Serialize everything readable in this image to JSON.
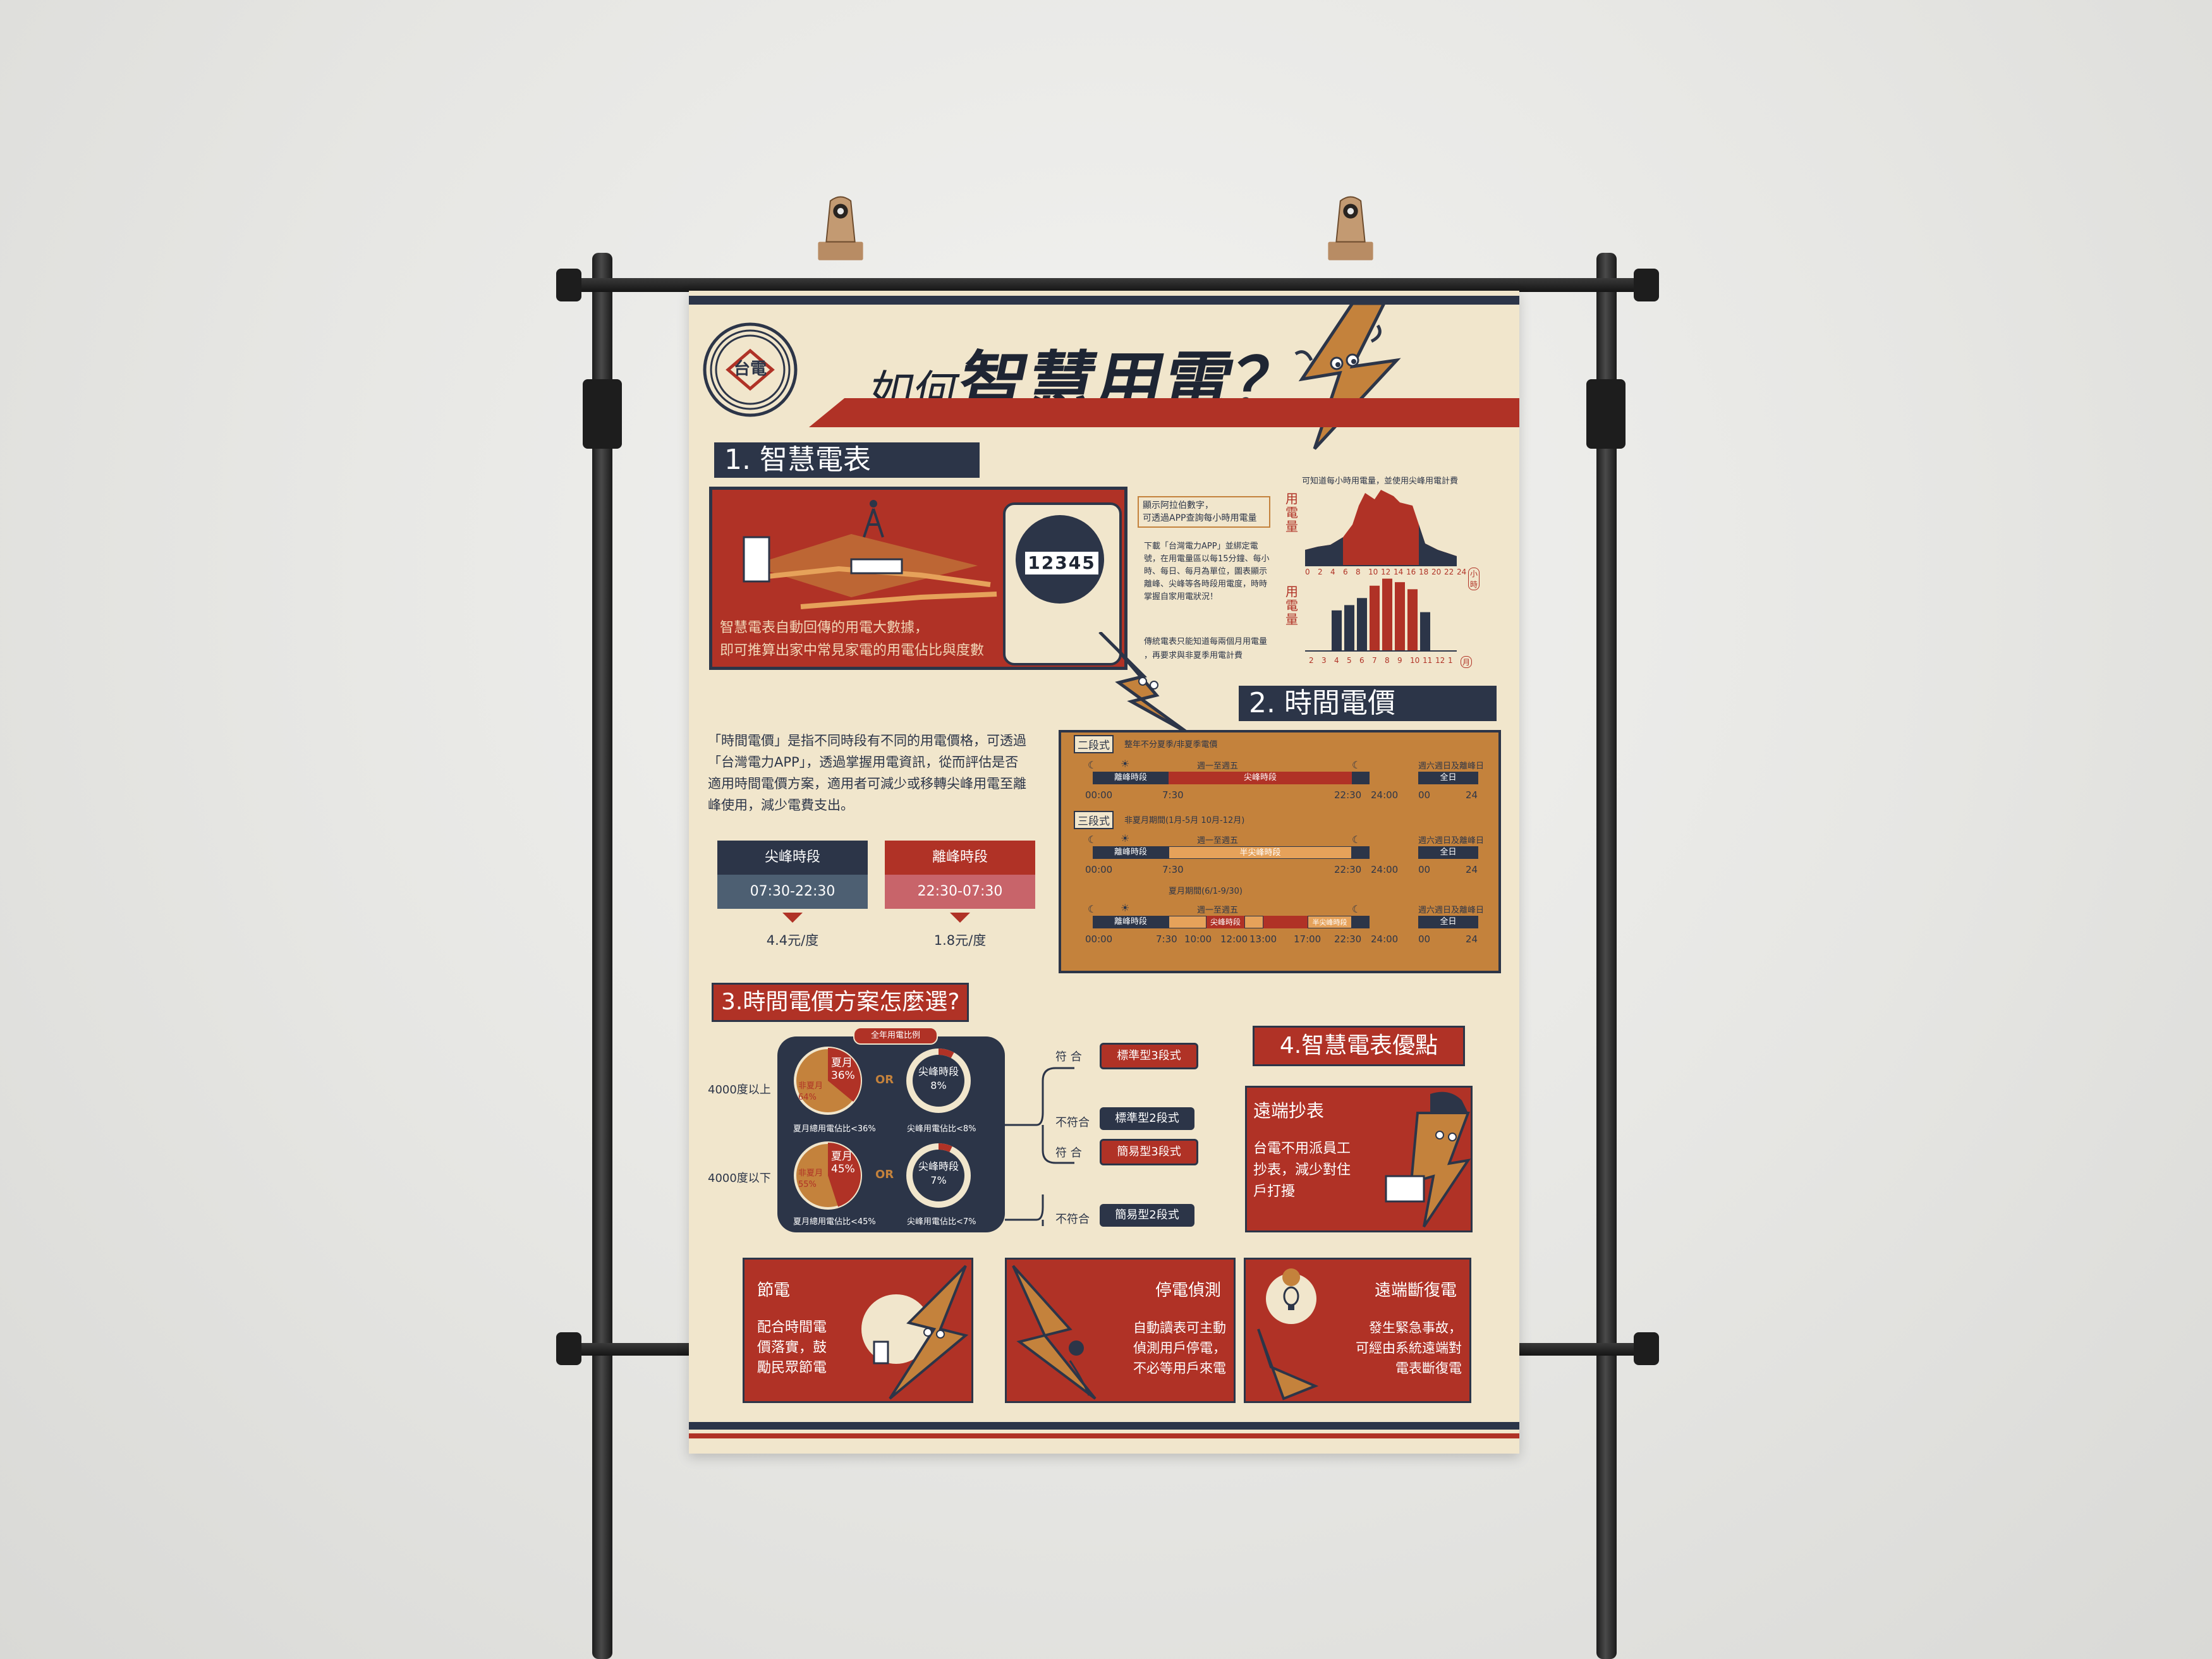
{
  "poster": {
    "title_prefix": "如何",
    "title_main": "智慧用電？",
    "logo_text": "台電",
    "colors": {
      "navy": "#2c3548",
      "red": "#b03226",
      "ochre": "#c4823c",
      "cream": "#f1e6cc"
    },
    "section1": {
      "heading": "1. 智慧電表",
      "meter_number": "12345",
      "caption_line1": "智慧電表自動回傳的用電大數據，",
      "caption_line2": "即可推算出家中常見家電的用電佔比與度數",
      "note1_line1": "顯示阿拉伯數字，",
      "note1_line2": "可透過APP查詢每小時用電量",
      "note2": "下載「台灣電力APP」並綁定電號，在用電量區以每15分鐘、每小時、每日、每月為單位，圖表顯示離峰、尖峰等各時段用電度，時時掌握自家用電狀況！",
      "note3_line1": "傳統電表只能知道每兩個月用電量",
      "note3_line2": "，再要求與非夏季用電計費",
      "chart_top_note": "可知道每小時用電量，並使用尖峰用電計費",
      "chart_ylabel": "用電量"
    },
    "chart_data": [
      {
        "type": "area",
        "ylabel": "用電量",
        "x_ticks": [
          "0",
          "2",
          "4",
          "6",
          "8",
          "10",
          "12",
          "14",
          "16",
          "18",
          "20",
          "22",
          "24"
        ],
        "x_unit": "小時"
      },
      {
        "type": "bar",
        "ylabel": "用電量",
        "categories": [
          "2",
          "3",
          "4",
          "5",
          "6",
          "7",
          "8",
          "9",
          "10",
          "11",
          "12",
          "1"
        ],
        "values": [
          0,
          0,
          2.3,
          2.6,
          3.0,
          3.7,
          4.1,
          3.9,
          3.5,
          2.2,
          0,
          0
        ],
        "x_unit": "月"
      }
    ],
    "section2": {
      "heading": "2. 時間電價",
      "body_line1": "「時間電價」是指不同時段有不同的用電價格，可透過",
      "body_line2": "「台灣電力APP」，透過掌握用電資訊，從而評估是否",
      "body_line3": "適用時間電價方案，適用者可減少或移轉尖峰用電至離",
      "body_line4": "峰使用，減少電費支出。",
      "peak_label": "尖峰時段",
      "peak_time": "07:30-22:30",
      "peak_price": "4.4元/度",
      "offpeak_label": "離峰時段",
      "offpeak_time": "22:30-07:30",
      "offpeak_price": "1.8元/度",
      "two_stage": {
        "tag": "二段式",
        "note": "整年不分夏季/非夏季電價",
        "weekday": "週一至週五",
        "offpeak": "離峰時段",
        "peak": "尖峰時段",
        "weekend": "週六週日及離峰日",
        "allday": "全日",
        "ticks_left": [
          "00:00",
          "7:30"
        ],
        "ticks_right": [
          "22:30",
          "24:00"
        ],
        "we_ticks": [
          "00",
          "24"
        ]
      },
      "three_stage": {
        "tag": "三段式",
        "note": "非夏月期間(1月-5月 10月-12月)",
        "weekday": "週一至週五",
        "offpeak": "離峰時段",
        "halfpeak": "半尖峰時段",
        "weekend": "週六週日及離峰日",
        "allday": "全日",
        "ticks_left": [
          "00:00",
          "7:30"
        ],
        "ticks_right": [
          "22:30",
          "24:00"
        ],
        "we_ticks": [
          "00",
          "24"
        ],
        "summer_note": "夏月期間(6/1-9/30)",
        "summer_weekday": "週一至週五",
        "summer_seg_off": "離峰時段",
        "summer_seg_peak": "尖峰時段",
        "summer_seg_half": "半尖峰時段",
        "summer_ticks": [
          "00:00",
          "7:30",
          "10:00",
          "12:00",
          "13:00",
          "17:00",
          "22:30",
          "24:00"
        ],
        "summer_weekend": "週六週日及離峰日",
        "summer_allday": "全日",
        "summer_we_ticks": [
          "00",
          "24"
        ]
      }
    },
    "section3": {
      "heading": "3.時間電價方案怎麼選?",
      "tab": "全年用電比例",
      "row1_label": "4000度以上",
      "row2_label": "4000度以下",
      "pie1": {
        "summer": "夏月",
        "summer_pct": "36%",
        "nonsummer": "非夏月",
        "nonsummer_pct": "64%",
        "caption": "夏月總用電佔比<36%",
        "summer_value": 36
      },
      "ring1": {
        "label": "尖峰時段",
        "pct": "8%",
        "caption": "尖峰用電佔比<8%",
        "value": 8
      },
      "pie2": {
        "summer": "夏月",
        "summer_pct": "45%",
        "nonsummer": "非夏月",
        "nonsummer_pct": "55%",
        "caption": "夏月總用電佔比<45%",
        "summer_value": 45
      },
      "ring2": {
        "label": "尖峰時段",
        "pct": "7%",
        "caption": "尖峰用電佔比<7%",
        "value": 7
      },
      "or": "OR",
      "match": "符 合",
      "nomatch": "不符合",
      "plan1": "標準型3段式",
      "plan2": "標準型2段式",
      "plan3": "簡易型3段式",
      "plan4": "簡易型2段式"
    },
    "section4": {
      "heading": "4.智慧電表優點",
      "card1_title": "遠端抄表",
      "card1_line1": "台電不用派員工",
      "card1_line2": "抄表，減少對住",
      "card1_line3": "戶打擾",
      "card2_title": "節電",
      "card2_line1": "配合時間電",
      "card2_line2": "價落實，鼓",
      "card2_line3": "勵民眾節電",
      "card3_title": "停電偵測",
      "card3_line1": "自動讀表可主動",
      "card3_line2": "偵測用戶停電，",
      "card3_line3": "不必等用戶來電",
      "card4_title": "遠端斷復電",
      "card4_line1": "發生緊急事故，",
      "card4_line2": "可經由系統遠端對",
      "card4_line3": "電表斷復電"
    }
  }
}
